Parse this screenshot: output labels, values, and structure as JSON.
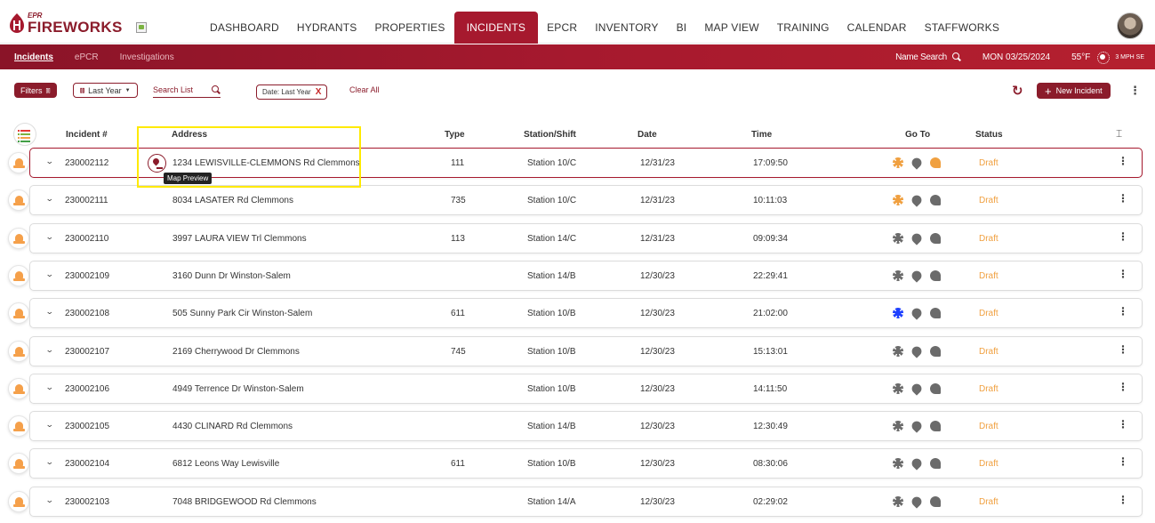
{
  "brand": {
    "small": "EPR",
    "name": "FIREWORKS"
  },
  "nav": [
    "DASHBOARD",
    "HYDRANTS",
    "PROPERTIES",
    "INCIDENTS",
    "EPCR",
    "INVENTORY",
    "BI",
    "MAP VIEW",
    "TRAINING",
    "CALENDAR",
    "STAFFWORKS"
  ],
  "nav_active": "INCIDENTS",
  "subtabs": [
    "Incidents",
    "ePCR",
    "Investigations"
  ],
  "subtab_active": "Incidents",
  "subright": {
    "name_search": "Name Search",
    "date": "MON 03/25/2024",
    "temp": "55°F",
    "wind": "3 MPH SE"
  },
  "toolbar": {
    "filters": "Filters",
    "period": "Last Year",
    "search_list": "Search List",
    "chip": "Date: Last Year",
    "chip_close": "X",
    "clear_all": "Clear All",
    "new_incident": "New Incident"
  },
  "columns": {
    "incident": "Incident #",
    "address": "Address",
    "type": "Type",
    "station": "Station/Shift",
    "date": "Date",
    "time": "Time",
    "goto": "Go To",
    "status": "Status"
  },
  "tooltip": "Map Preview",
  "colors": {
    "accent": "#a6192e",
    "status_draft": "#f0a040",
    "goto_orange": "#f0a040",
    "goto_blue": "#1e40ff",
    "goto_gray": "#6b6b6b"
  },
  "rows": [
    {
      "incident": "230002112",
      "address": "1234 LEWISVILLE-CLEMMONS Rd Clemmons",
      "type": "111",
      "station": "Station 10/C",
      "date": "12/31/23",
      "time": "17:09:50",
      "status": "Draft",
      "goto": [
        "orange",
        "gray",
        "orange"
      ]
    },
    {
      "incident": "230002111",
      "address": "8034 LASATER Rd Clemmons",
      "type": "735",
      "station": "Station 10/C",
      "date": "12/31/23",
      "time": "10:11:03",
      "status": "Draft",
      "goto": [
        "orange",
        "gray",
        "gray"
      ]
    },
    {
      "incident": "230002110",
      "address": "3997 LAURA VIEW Trl Clemmons",
      "type": "113",
      "station": "Station 14/C",
      "date": "12/31/23",
      "time": "09:09:34",
      "status": "Draft",
      "goto": [
        "gray",
        "gray",
        "gray"
      ]
    },
    {
      "incident": "230002109",
      "address": "3160 Dunn Dr Winston-Salem",
      "type": "",
      "station": "Station 14/B",
      "date": "12/30/23",
      "time": "22:29:41",
      "status": "Draft",
      "goto": [
        "gray",
        "gray",
        "gray"
      ]
    },
    {
      "incident": "230002108",
      "address": "505 Sunny Park Cir Winston-Salem",
      "type": "611",
      "station": "Station 10/B",
      "date": "12/30/23",
      "time": "21:02:00",
      "status": "Draft",
      "goto": [
        "blue",
        "gray",
        "gray"
      ]
    },
    {
      "incident": "230002107",
      "address": "2169 Cherrywood Dr Clemmons",
      "type": "745",
      "station": "Station 10/B",
      "date": "12/30/23",
      "time": "15:13:01",
      "status": "Draft",
      "goto": [
        "gray",
        "gray",
        "gray"
      ]
    },
    {
      "incident": "230002106",
      "address": "4949 Terrence Dr Winston-Salem",
      "type": "",
      "station": "Station 10/B",
      "date": "12/30/23",
      "time": "14:11:50",
      "status": "Draft",
      "goto": [
        "gray",
        "gray",
        "gray"
      ]
    },
    {
      "incident": "230002105",
      "address": "4430 CLINARD Rd Clemmons",
      "type": "",
      "station": "Station 14/B",
      "date": "12/30/23",
      "time": "12:30:49",
      "status": "Draft",
      "goto": [
        "gray",
        "gray",
        "gray"
      ]
    },
    {
      "incident": "230002104",
      "address": "6812 Leons Way Lewisville",
      "type": "611",
      "station": "Station 10/B",
      "date": "12/30/23",
      "time": "08:30:06",
      "status": "Draft",
      "goto": [
        "gray",
        "gray",
        "gray"
      ]
    },
    {
      "incident": "230002103",
      "address": "7048 BRIDGEWOOD Rd Clemmons",
      "type": "",
      "station": "Station 14/A",
      "date": "12/30/23",
      "time": "02:29:02",
      "status": "Draft",
      "goto": [
        "gray",
        "gray",
        "gray"
      ]
    }
  ]
}
